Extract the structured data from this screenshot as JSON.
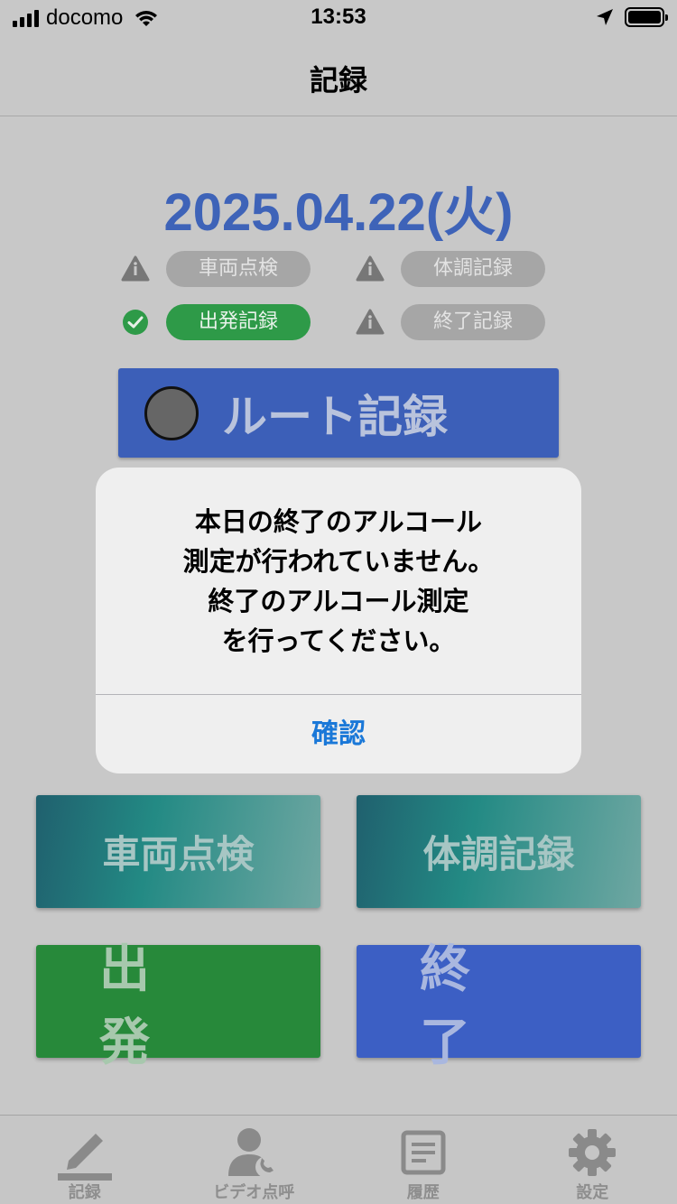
{
  "status_bar": {
    "carrier": "docomo",
    "time": "13:53"
  },
  "nav": {
    "title": "記録"
  },
  "date": "2025.04.22(火)",
  "status_items": [
    {
      "label": "車両点検",
      "state": "incomplete",
      "icon": "info-icon"
    },
    {
      "label": "体調記録",
      "state": "incomplete",
      "icon": "info-icon"
    },
    {
      "label": "出発記録",
      "state": "done",
      "icon": "check-circle-icon"
    },
    {
      "label": "終了記録",
      "state": "incomplete",
      "icon": "info-icon"
    }
  ],
  "route_button": {
    "label": "ルート記録"
  },
  "actions": {
    "vehicle_check": "車両点検",
    "health_record": "体調記録",
    "depart": "出発",
    "finish": "終了"
  },
  "alert": {
    "message_lines": [
      "本日の終了のアルコール",
      "測定が行われていません。",
      "終了のアルコール測定",
      "を行ってください。"
    ],
    "confirm": "確認"
  },
  "tabs": [
    {
      "label": "記録",
      "icon": "pencil-icon",
      "active": true
    },
    {
      "label": "ビデオ点呼",
      "icon": "video-call-person-icon",
      "active": false
    },
    {
      "label": "履歴",
      "icon": "history-doc-icon",
      "active": false
    },
    {
      "label": "設定",
      "icon": "gear-icon",
      "active": false
    }
  ],
  "colors": {
    "date": "#3e63b8",
    "pill_incomplete": "#a6a6a6",
    "pill_done": "#2e9a48",
    "route_button": "#3c5fb8",
    "depart_button": "#27893a",
    "finish_button": "#3c5fc4",
    "alert_action": "#1a78d8"
  }
}
